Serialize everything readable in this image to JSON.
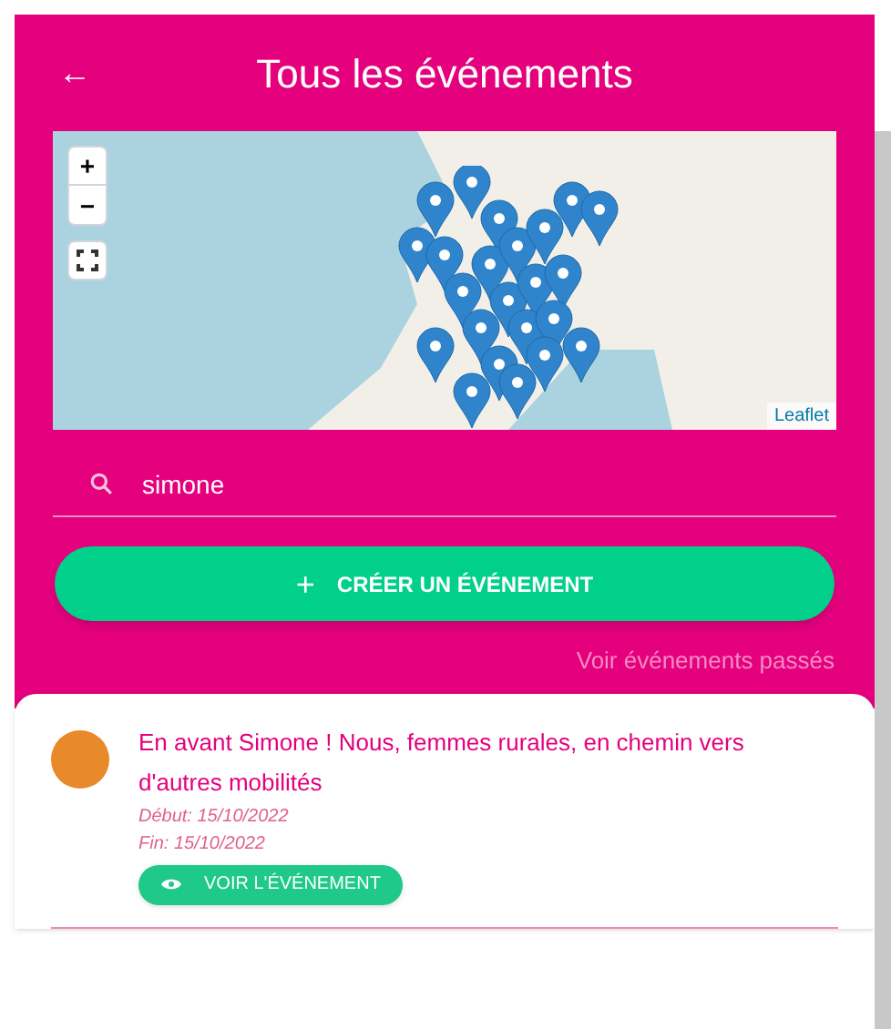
{
  "header": {
    "back": "←",
    "title": "Tous les événements"
  },
  "map": {
    "zoom_in": "+",
    "zoom_out": "−",
    "attribution": "Leaflet"
  },
  "search": {
    "value": "simone"
  },
  "create_button": {
    "icon": "+",
    "label": "CRÉER UN ÉVÉNEMENT"
  },
  "past_link": "Voir événements passés",
  "events": [
    {
      "title": "En avant Simone ! Nous, femmes rurales, en chemin vers d'autres mobilités",
      "start": "Début: 15/10/2022",
      "end": "Fin: 15/10/2022",
      "button": "VOIR L'ÉVÉNEMENT"
    }
  ]
}
